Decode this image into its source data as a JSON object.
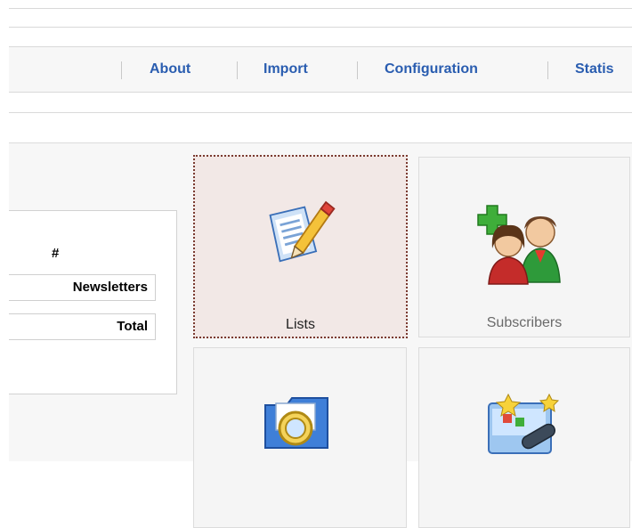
{
  "nav": {
    "items": [
      {
        "label": "About"
      },
      {
        "label": "Import"
      },
      {
        "label": "Configuration"
      },
      {
        "label": "Statis"
      }
    ]
  },
  "stats": {
    "header": "#",
    "rows": [
      {
        "label": "Newsletters"
      },
      {
        "label": "Total"
      }
    ]
  },
  "tiles": [
    {
      "label": "Lists",
      "icon": "lists-icon",
      "active": true
    },
    {
      "label": "Subscribers",
      "icon": "subscribers-icon",
      "active": false
    },
    {
      "label": "",
      "icon": "folder-search-icon",
      "active": false
    },
    {
      "label": "",
      "icon": "statistics-icon",
      "active": false
    }
  ],
  "colors": {
    "link": "#2a5db0",
    "active_tile_bg": "#f2e8e6",
    "active_tile_border": "#7a3a30"
  }
}
